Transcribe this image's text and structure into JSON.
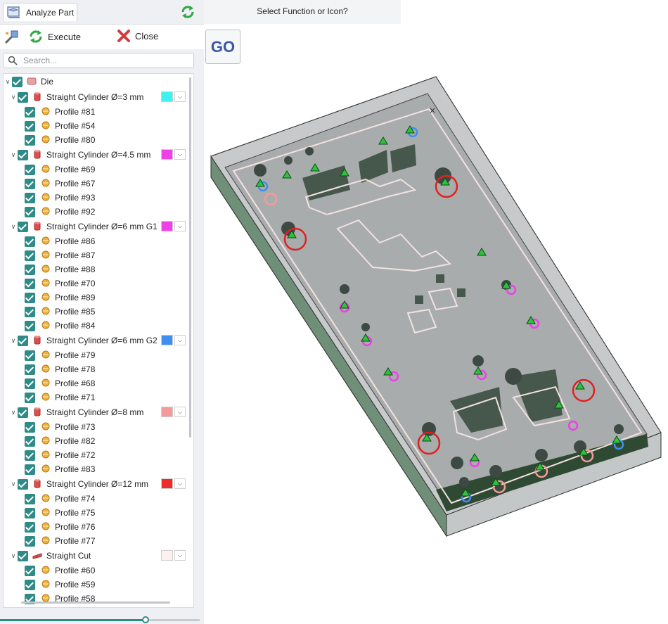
{
  "panel": {
    "tab_title": "Analyze Part",
    "execute_label": "Execute",
    "close_label": "Close",
    "search_placeholder": "Search...",
    "root_label": "Die",
    "groups": [
      {
        "label": "Straight Cylinder Ø=3 mm",
        "color": "#3ff2f2",
        "profiles": [
          "Profile #81",
          "Profile #54",
          "Profile #80"
        ]
      },
      {
        "label": "Straight Cylinder Ø=4.5 mm",
        "color": "#ee3fe9",
        "profiles": [
          "Profile #69",
          "Profile #67",
          "Profile #93",
          "Profile #92"
        ]
      },
      {
        "label": "Straight Cylinder Ø=6 mm G1",
        "color": "#ee3fe9",
        "profiles": [
          "Profile #86",
          "Profile #87",
          "Profile #88",
          "Profile #70",
          "Profile #89",
          "Profile #85",
          "Profile #84"
        ]
      },
      {
        "label": "Straight Cylinder Ø=6 mm G2",
        "color": "#3d8ff0",
        "profiles": [
          "Profile #79",
          "Profile #78",
          "Profile #68",
          "Profile #71"
        ]
      },
      {
        "label": "Straight Cylinder Ø=8 mm",
        "color": "#f59a9a",
        "profiles": [
          "Profile #73",
          "Profile #82",
          "Profile #72",
          "Profile #83"
        ]
      },
      {
        "label": "Straight Cylinder Ø=12 mm",
        "color": "#ee2a2a",
        "profiles": [
          "Profile #74",
          "Profile #75",
          "Profile #76",
          "Profile #77"
        ]
      },
      {
        "label": "Straight Cut",
        "color": "#fcf0f0",
        "profiles": [
          "Profile #60",
          "Profile #59",
          "Profile #58"
        ]
      }
    ],
    "slider_value": 0.73
  },
  "prompt": "Select Function or Icon?",
  "go_label": "GO",
  "icons": [
    "analyze-part-icon",
    "refresh-icon",
    "execute-icon",
    "close-icon",
    "search-icon",
    "die-icon",
    "cylinder-icon",
    "cut-icon",
    "profile-icon"
  ]
}
